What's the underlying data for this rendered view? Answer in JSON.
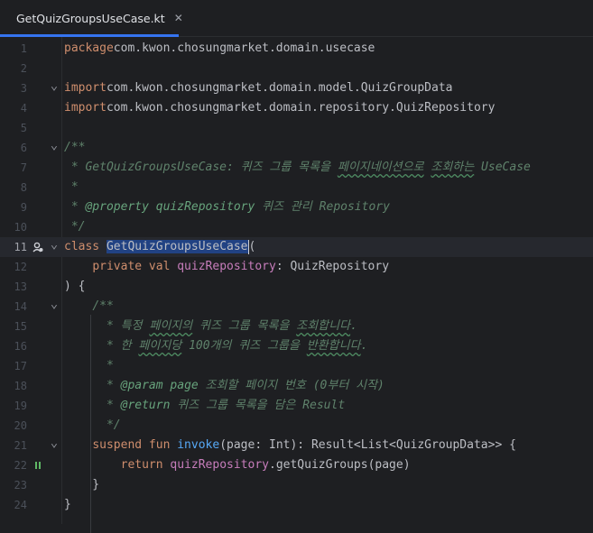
{
  "tab": {
    "filename": "GetQuizGroupsUseCase.kt"
  },
  "lines": [
    {
      "n": "1",
      "parts": [
        [
          "kw",
          "package"
        ],
        [
          "",
          "com.kwon.chosungmarket.domain.usecase"
        ]
      ]
    },
    {
      "n": "2",
      "parts": []
    },
    {
      "n": "3",
      "fold": true,
      "parts": [
        [
          "kw",
          "import"
        ],
        [
          "",
          "com.kwon.chosungmarket.domain.model.QuizGroupData"
        ]
      ]
    },
    {
      "n": "4",
      "parts": [
        [
          "kw",
          "import"
        ],
        [
          "",
          "com.kwon.chosungmarket.domain.repository.QuizRepository"
        ]
      ]
    },
    {
      "n": "5",
      "parts": []
    },
    {
      "n": "6",
      "fold": true,
      "parts": [
        [
          "doc",
          "/**"
        ]
      ]
    },
    {
      "n": "7",
      "parts": [
        [
          "doc",
          " * GetQuizGroupsUseCase: 퀴즈 그룹 목록을 "
        ],
        [
          "doc wavy",
          "페이지네이션으로"
        ],
        [
          "doc",
          " "
        ],
        [
          "doc wavy",
          "조회하는"
        ],
        [
          "doc",
          " UseCase"
        ]
      ]
    },
    {
      "n": "8",
      "parts": [
        [
          "doc",
          " *"
        ]
      ]
    },
    {
      "n": "9",
      "parts": [
        [
          "doc",
          " * "
        ],
        [
          "doctag",
          "@property"
        ],
        [
          "doc",
          " "
        ],
        [
          "docbold",
          "quizRepository"
        ],
        [
          "doc",
          " 퀴즈 관리 Repository"
        ]
      ]
    },
    {
      "n": "10",
      "parts": [
        [
          "doc",
          " */"
        ]
      ]
    },
    {
      "n": "11",
      "fold": true,
      "current": true,
      "icon": "person-run-icon",
      "parts": [
        [
          "kw",
          "class"
        ],
        [
          "",
          " "
        ],
        [
          "sel",
          "GetQuizGroupsUseCase"
        ],
        [
          "caret",
          ""
        ],
        [
          "",
          "("
        ]
      ]
    },
    {
      "n": "12",
      "parts": [
        [
          "",
          "    "
        ],
        [
          "kw",
          "private val"
        ],
        [
          "",
          " "
        ],
        [
          "prop",
          "quizRepository"
        ],
        [
          "",
          ": QuizRepository"
        ]
      ]
    },
    {
      "n": "13",
      "parts": [
        [
          "",
          ") {"
        ]
      ]
    },
    {
      "n": "14",
      "fold": true,
      "parts": [
        [
          "",
          "    "
        ],
        [
          "doc",
          "/**"
        ]
      ]
    },
    {
      "n": "15",
      "parts": [
        [
          "",
          "    "
        ],
        [
          "doc",
          "  * 특정 "
        ],
        [
          "doc wavy",
          "페이지의"
        ],
        [
          "doc",
          " 퀴즈 그룹 목록을 "
        ],
        [
          "doc wavy",
          "조회합니다"
        ],
        [
          "doc",
          "."
        ]
      ]
    },
    {
      "n": "16",
      "parts": [
        [
          "",
          "    "
        ],
        [
          "doc",
          "  * 한 "
        ],
        [
          "doc wavy",
          "페이지당"
        ],
        [
          "doc",
          " 100개의 퀴즈 그룹을 "
        ],
        [
          "doc wavy",
          "반환합니다"
        ],
        [
          "doc",
          "."
        ]
      ]
    },
    {
      "n": "17",
      "parts": [
        [
          "",
          "    "
        ],
        [
          "doc",
          "  *"
        ]
      ]
    },
    {
      "n": "18",
      "parts": [
        [
          "",
          "    "
        ],
        [
          "doc",
          "  * "
        ],
        [
          "doctag",
          "@param"
        ],
        [
          "doc",
          " "
        ],
        [
          "docbold",
          "page"
        ],
        [
          "doc",
          " 조회할 페이지 번호 (0부터 시작)"
        ]
      ]
    },
    {
      "n": "19",
      "parts": [
        [
          "",
          "    "
        ],
        [
          "doc",
          "  * "
        ],
        [
          "doctag",
          "@return"
        ],
        [
          "doc",
          " 퀴즈 그룹 목록을 담은 Result"
        ]
      ]
    },
    {
      "n": "20",
      "parts": [
        [
          "",
          "    "
        ],
        [
          "doc",
          "  */"
        ]
      ]
    },
    {
      "n": "21",
      "fold": true,
      "parts": [
        [
          "",
          "    "
        ],
        [
          "kw",
          "suspend fun"
        ],
        [
          "",
          " "
        ],
        [
          "fn",
          "invoke"
        ],
        [
          "",
          "(page: Int): Result<List<QuizGroupData>> {"
        ]
      ]
    },
    {
      "n": "22",
      "icon": "pause-icon",
      "parts": [
        [
          "",
          "        "
        ],
        [
          "kw",
          "return"
        ],
        [
          "",
          " "
        ],
        [
          "prop",
          "quizRepository"
        ],
        [
          "",
          ".getQuizGroups(page)"
        ]
      ]
    },
    {
      "n": "23",
      "parts": [
        [
          "",
          "    }"
        ]
      ]
    },
    {
      "n": "24",
      "parts": [
        [
          "",
          "}"
        ]
      ]
    }
  ],
  "colors": {
    "accent": "#3574f0",
    "keyword": "#cf8e6d",
    "function": "#56a8f5",
    "property": "#c77dbb",
    "doc": "#5f826b"
  }
}
